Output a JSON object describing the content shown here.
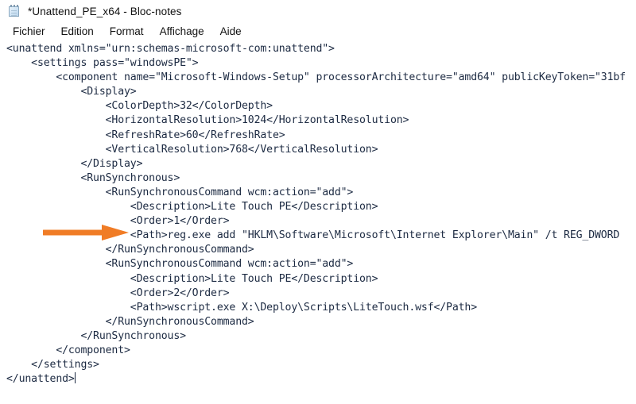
{
  "window": {
    "title": "*Unattend_PE_x64 - Bloc-notes",
    "icon": "notepad-icon",
    "app": "Bloc-notes"
  },
  "menu": {
    "items": [
      {
        "label": "Fichier"
      },
      {
        "label": "Edition"
      },
      {
        "label": "Format"
      },
      {
        "label": "Affichage"
      },
      {
        "label": "Aide"
      }
    ]
  },
  "editor": {
    "language": "xml",
    "cursor_after_line": 20,
    "lines": [
      "<unattend xmlns=\"urn:schemas-microsoft-com:unattend\">",
      "    <settings pass=\"windowsPE\">",
      "        <component name=\"Microsoft-Windows-Setup\" processorArchitecture=\"amd64\" publicKeyToken=\"31bf",
      "            <Display>",
      "                <ColorDepth>32</ColorDepth>",
      "                <HorizontalResolution>1024</HorizontalResolution>",
      "                <RefreshRate>60</RefreshRate>",
      "                <VerticalResolution>768</VerticalResolution>",
      "            </Display>",
      "            <RunSynchronous>",
      "                <RunSynchronousCommand wcm:action=\"add\">",
      "                    <Description>Lite Touch PE</Description>",
      "                    <Order>1</Order>",
      "                    <Path>reg.exe add \"HKLM\\Software\\Microsoft\\Internet Explorer\\Main\" /t REG_DWORD",
      "                </RunSynchronousCommand>",
      "                <RunSynchronousCommand wcm:action=\"add\">",
      "                    <Description>Lite Touch PE</Description>",
      "                    <Order>2</Order>",
      "                    <Path>wscript.exe X:\\Deploy\\Scripts\\LiteTouch.wsf</Path>",
      "                </RunSynchronousCommand>",
      "            </RunSynchronous>",
      "        </component>",
      "    </settings>",
      "</unattend>"
    ]
  },
  "annotation": {
    "arrow": {
      "name": "orange-arrow",
      "color": "#F07C26",
      "points_to_line": "<Path>reg.exe add \"HKLM\\Software\\Microsoft\\Internet Explorer\\Main\" /t REG_DWORD",
      "direction": "right"
    }
  },
  "colors": {
    "background": "#FFFFFF",
    "text": "#1C2A42",
    "title_text": "#111111",
    "accent": "#F07C26"
  }
}
